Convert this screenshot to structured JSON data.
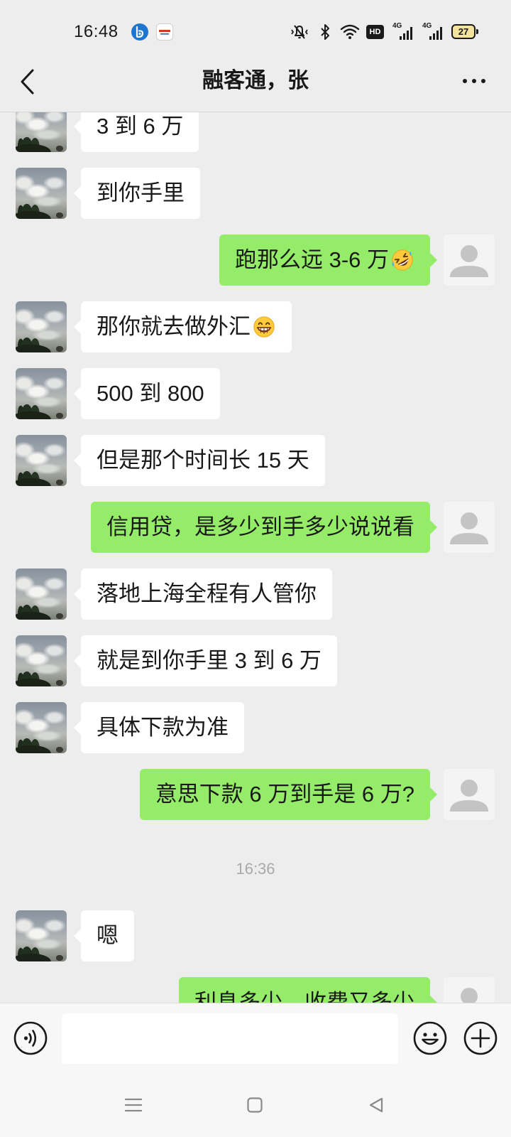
{
  "status_bar": {
    "time": "16:48",
    "hd_label": "HD",
    "sim1_network": "4G",
    "sim2_network": "4G",
    "battery_level": "27",
    "icons": [
      "app-notification-icon",
      "app-notification-icon",
      "mute-icon",
      "bluetooth-icon",
      "wifi-icon",
      "hd-icon",
      "signal-icon",
      "signal-icon",
      "battery-icon"
    ]
  },
  "header": {
    "title": "融客通，张",
    "back_icon": "back-chevron-icon",
    "more_icon": "more-dots-icon"
  },
  "chat": {
    "messages": [
      {
        "type": "message",
        "sender": "contact",
        "text": "3 到 6 万"
      },
      {
        "type": "message",
        "sender": "contact",
        "text": "到你手里"
      },
      {
        "type": "message",
        "sender": "me",
        "text": "跑那么远 3-6 万",
        "emoji": "rolling-on-the-floor-laughing-emoji-icon"
      },
      {
        "type": "message",
        "sender": "contact",
        "text": "那你就去做外汇",
        "emoji": "grinning-face-emoji-icon"
      },
      {
        "type": "message",
        "sender": "contact",
        "text": "500 到 800"
      },
      {
        "type": "message",
        "sender": "contact",
        "text": "但是那个时间长 15 天"
      },
      {
        "type": "message",
        "sender": "me",
        "text": "信用贷，是多少到手多少说说看"
      },
      {
        "type": "message",
        "sender": "contact",
        "text": "落地上海全程有人管你"
      },
      {
        "type": "message",
        "sender": "contact",
        "text": "就是到你手里 3 到 6 万"
      },
      {
        "type": "message",
        "sender": "contact",
        "text": "具体下款为准"
      },
      {
        "type": "message",
        "sender": "me",
        "text": "意思下款 6 万到手是 6 万?"
      },
      {
        "type": "timestamp",
        "text": "16:36"
      },
      {
        "type": "message",
        "sender": "contact",
        "text": "嗯"
      },
      {
        "type": "message",
        "sender": "me",
        "text": "利息多少，收费又多少"
      }
    ]
  },
  "input_bar": {
    "voice_icon": "voice-input-icon",
    "value": "",
    "emoji_icon": "emoji-icon",
    "more_icon": "plus-icon"
  },
  "nav_bar": {
    "icons": [
      "menu-icon",
      "home-square-icon",
      "back-triangle-icon"
    ]
  },
  "colors": {
    "background": "#ededed",
    "incoming_bubble": "#ffffff",
    "outgoing_bubble": "#95ec69",
    "timestamp_text": "#a9a9a9",
    "bottom_bar": "#f7f7f7"
  }
}
